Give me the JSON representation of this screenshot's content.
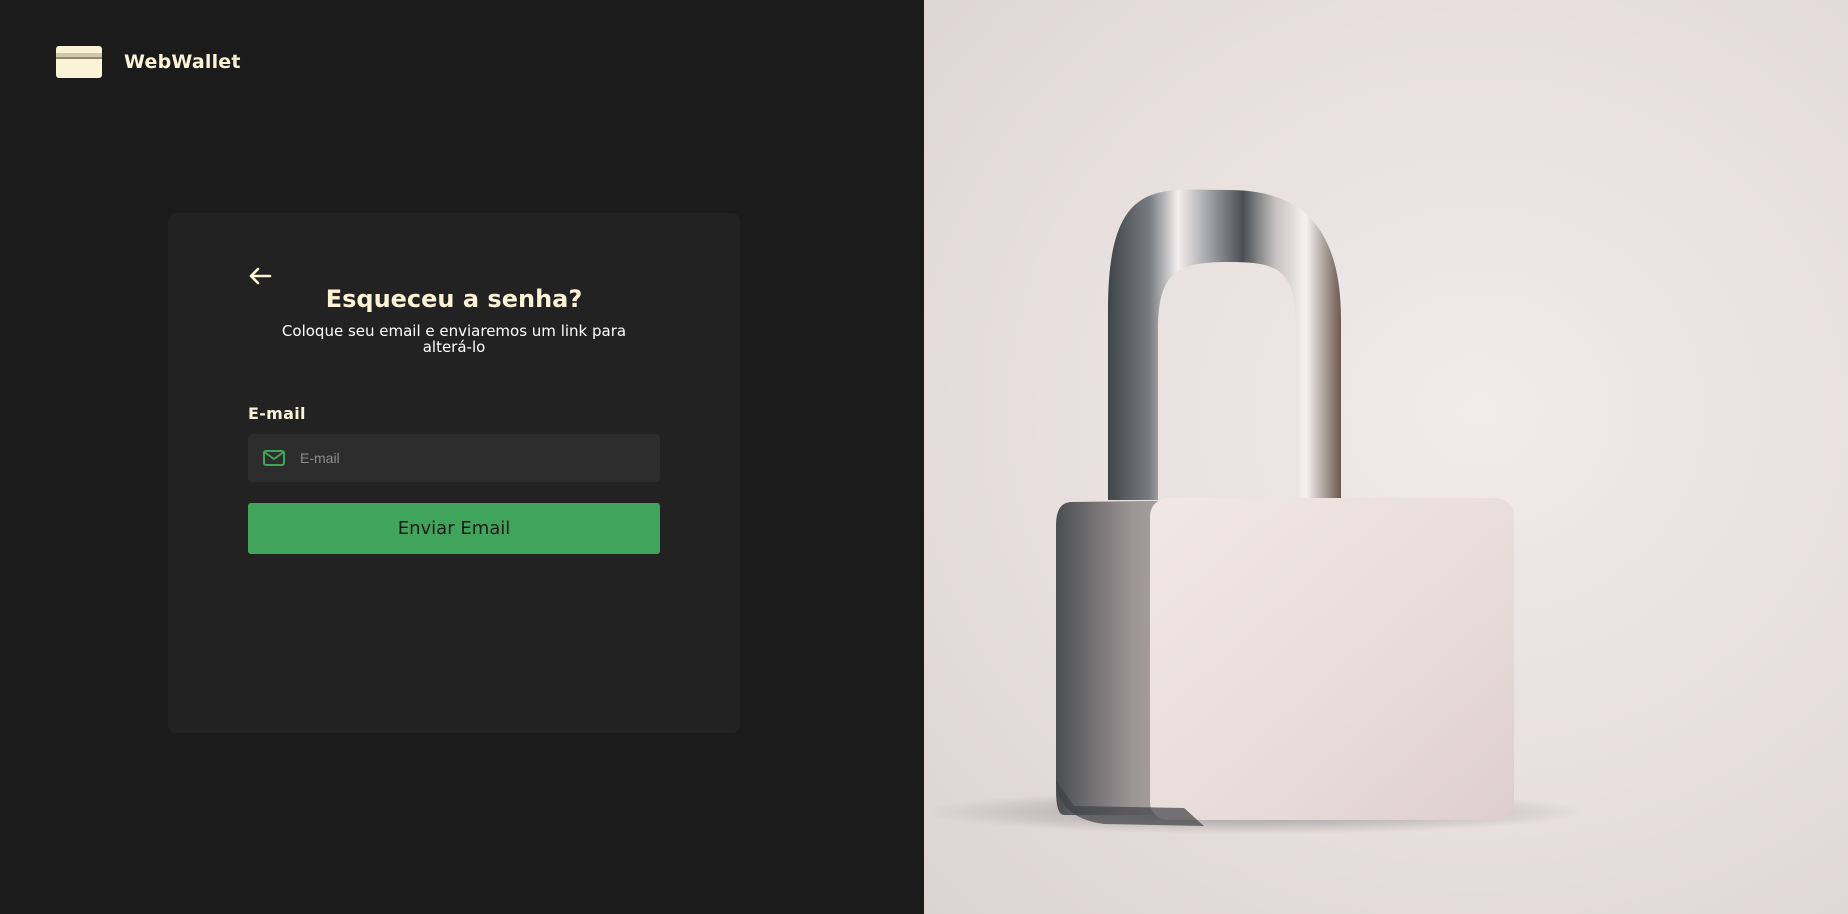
{
  "brand": {
    "name": "WebWallet",
    "icon": "credit-card-icon"
  },
  "form": {
    "back_icon": "arrow-left-icon",
    "title": "Esqueceu a senha?",
    "subtitle": "Coloque seu email e enviaremos um link para alterá-lo",
    "email_label": "E-mail",
    "email_placeholder": "E-mail",
    "email_value": "",
    "email_icon": "mail-icon",
    "submit_label": "Enviar Email"
  },
  "hero": {
    "image": "padlock-illustration"
  },
  "colors": {
    "background": "#1c1b1c",
    "card": "#222222",
    "accent": "#41a45b",
    "cream": "#fbf3d6",
    "input": "#2d2d2d"
  }
}
